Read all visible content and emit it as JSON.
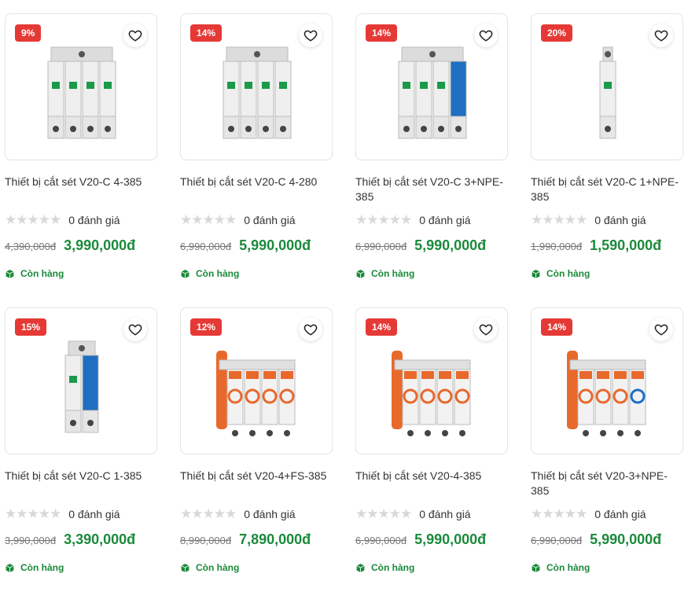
{
  "colors": {
    "badge": "#e53935",
    "price": "#1a8a3a",
    "stock": "#1a8a3a"
  },
  "products": [
    {
      "discount": "9%",
      "title": "Thiết bị cắt sét V20-C 4-385",
      "rating_text": "0 đánh giá",
      "old_price": "4,390,000đ",
      "new_price": "3,990,000đ",
      "stock": "Còn hàng",
      "image_icon": "surge-protector-grey-4pole"
    },
    {
      "discount": "14%",
      "title": "Thiết bị cắt sét V20-C 4-280",
      "rating_text": "0 đánh giá",
      "old_price": "6,990,000đ",
      "new_price": "5,990,000đ",
      "stock": "Còn hàng",
      "image_icon": "surge-protector-grey-4pole"
    },
    {
      "discount": "14%",
      "title": "Thiết bị cắt sét V20-C 3+NPE-385",
      "rating_text": "0 đánh giá",
      "old_price": "6,990,000đ",
      "new_price": "5,990,000đ",
      "stock": "Còn hàng",
      "image_icon": "surge-protector-grey-3pole-blue"
    },
    {
      "discount": "20%",
      "title": "Thiết bị cắt sét V20-C 1+NPE-385",
      "rating_text": "0 đánh giá",
      "old_price": "1,990,000đ",
      "new_price": "1,590,000đ",
      "stock": "Còn hàng",
      "image_icon": "surge-protector-grey-1pole"
    },
    {
      "discount": "15%",
      "title": "Thiết bị cắt sét V20-C 1-385",
      "rating_text": "0 đánh giá",
      "old_price": "3,990,000đ",
      "new_price": "3,390,000đ",
      "stock": "Còn hàng",
      "image_icon": "surge-protector-grey-1pole-blue"
    },
    {
      "discount": "12%",
      "title": "Thiết bị cắt sét V20-4+FS-385",
      "rating_text": "0 đánh giá",
      "old_price": "8,990,000đ",
      "new_price": "7,890,000đ",
      "stock": "Còn hàng",
      "image_icon": "surge-protector-orange-4pole"
    },
    {
      "discount": "14%",
      "title": "Thiết bị cắt sét V20-4-385",
      "rating_text": "0 đánh giá",
      "old_price": "6,990,000đ",
      "new_price": "5,990,000đ",
      "stock": "Còn hàng",
      "image_icon": "surge-protector-orange-4pole"
    },
    {
      "discount": "14%",
      "title": "Thiết bị cắt sét V20-3+NPE-385",
      "rating_text": "0 đánh giá",
      "old_price": "6,990,000đ",
      "new_price": "5,990,000đ",
      "stock": "Còn hàng",
      "image_icon": "surge-protector-orange-3pole-blue"
    }
  ]
}
